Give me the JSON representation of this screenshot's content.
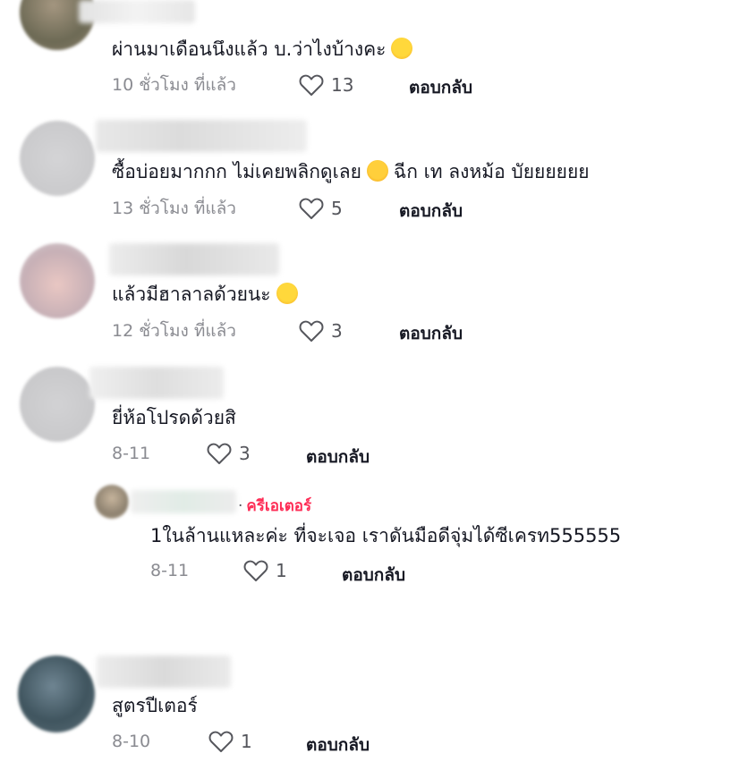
{
  "colors": {
    "text": "#161823",
    "meta": "#8a8b91",
    "creator_badge": "#fe2c55"
  },
  "comments": [
    {
      "text": "ผ่านมาเดือนนึงแล้ว บ.ว่าไงบ้างคะ",
      "emoji": "tears-of-joy-emoji",
      "time": "10 ชั่วโมง ที่แล้ว",
      "likes": "13",
      "reply": "ตอบกลับ"
    },
    {
      "text_before": "ซื้อบ่อยมากกก ไม่เคยพลิกดูเลย",
      "emoji": "flushed-face-emoji",
      "text_after": "ฉีก เท ลงหม้อ บัยยยยยย",
      "time": "13 ชั่วโมง ที่แล้ว",
      "likes": "5",
      "reply": "ตอบกลับ"
    },
    {
      "text": "แล้วมีฮาลาลด้วยนะ",
      "emoji": "grinning-sweat-emoji",
      "time": "12 ชั่วโมง ที่แล้ว",
      "likes": "3",
      "reply": "ตอบกลับ"
    },
    {
      "text": "ยี่ห้อโปรดด้วยสิ",
      "time": "8-11",
      "likes": "3",
      "reply": "ตอบกลับ",
      "replies": [
        {
          "badge_separator": "·",
          "badge": "ครีเอเตอร์",
          "text": "1ในล้านแหละค่ะ ที่จะเจอ เราดันมือดีจุ่มได้ซีเครท555555",
          "time": "8-11",
          "likes": "1",
          "reply": "ตอบกลับ"
        }
      ]
    },
    {
      "text": "สูตรปีเตอร์",
      "time": "8-10",
      "likes": "1",
      "reply": "ตอบกลับ"
    }
  ]
}
